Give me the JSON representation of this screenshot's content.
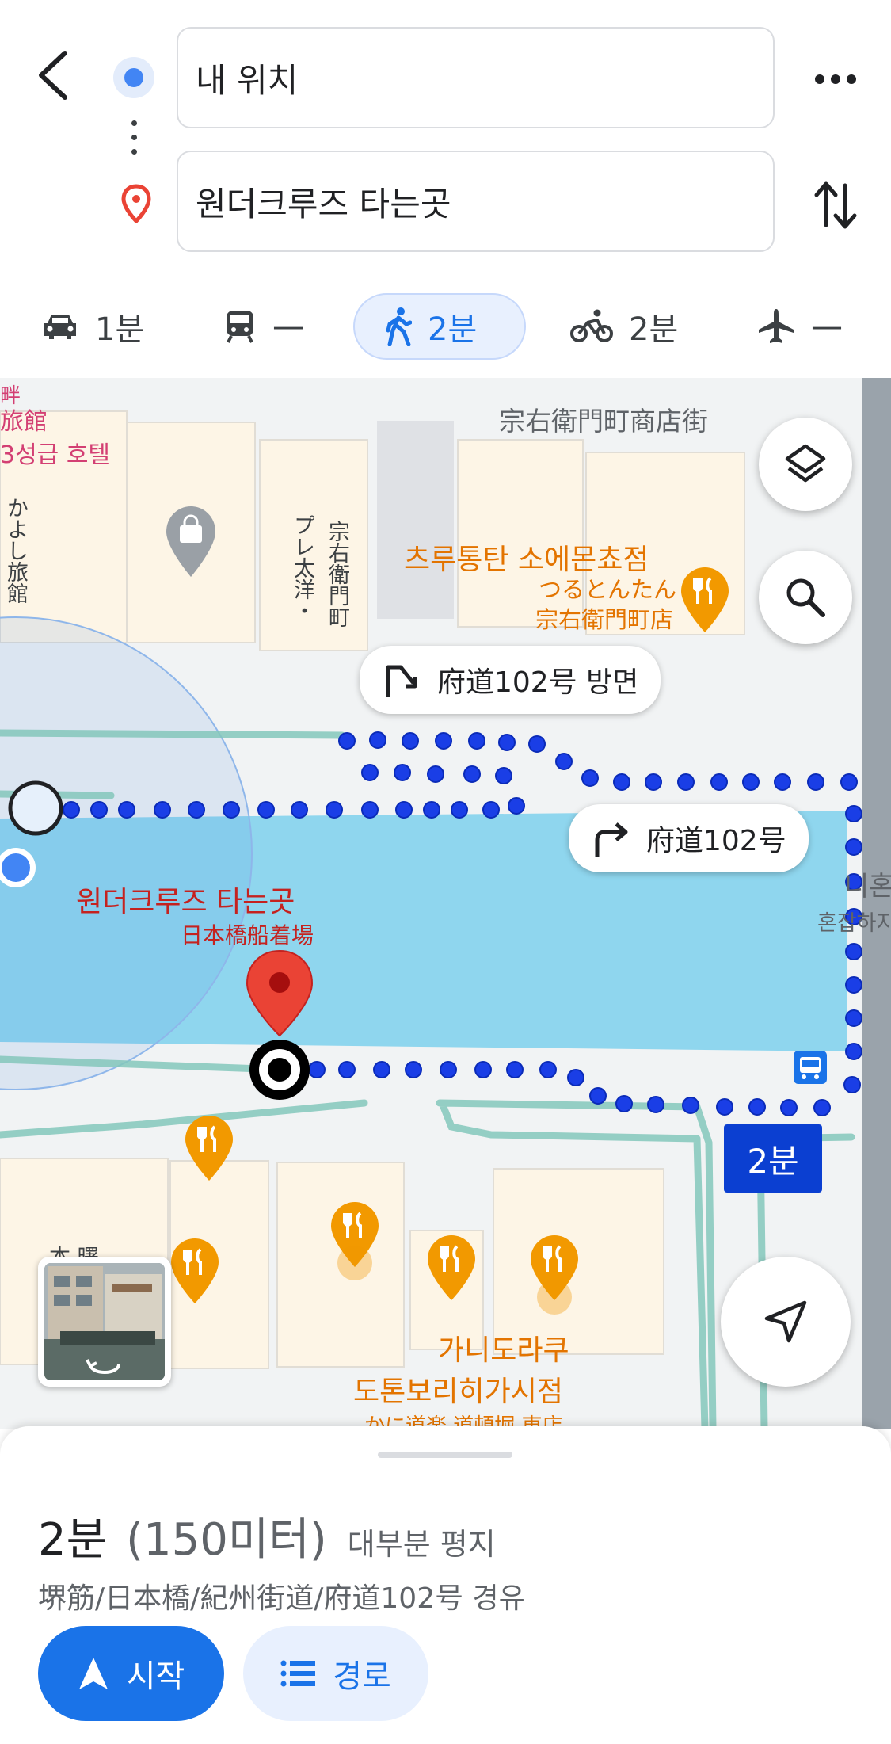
{
  "search": {
    "origin_value": "내 위치",
    "destination_value": "원더크루즈 타는곳"
  },
  "modes": [
    {
      "name": "driving",
      "label": "1분",
      "icon": "car-icon"
    },
    {
      "name": "transit",
      "label": "—",
      "icon": "train-icon"
    },
    {
      "name": "walking",
      "label": "2분",
      "icon": "walk-icon",
      "selected": true
    },
    {
      "name": "cycling",
      "label": "2분",
      "icon": "bike-icon"
    },
    {
      "name": "flight",
      "label": "—",
      "icon": "plane-icon"
    }
  ],
  "map": {
    "street_label": "宗右衛門町商店街",
    "hotel_label_1": "畔",
    "hotel_label_2": "旅館",
    "hotel_label_3": "3성급 호텔",
    "vertical_label_1": "かよし旅館",
    "vertical_label_2a": "プレ太洋・",
    "vertical_label_2b": "宗右衛門町",
    "restaurant_1_ko": "츠루통탄 소에몬쵸점",
    "restaurant_1_ja1": "つるとんたん",
    "restaurant_1_ja2": "宗右衛門町店",
    "restaurant_2_ko1": "가니도라쿠",
    "restaurant_2_ko2": "도톤보리히가시점",
    "restaurant_2_ja": "かに道楽 道頓堀 東店",
    "destination_ko": "원더크루즈 타는곳",
    "destination_ja": "日本橋船着場",
    "right_label_1": "니혼",
    "right_label_2": "혼잡하지",
    "callout_1": "府道102号 방면",
    "callout_2": "府道102号",
    "duration_badge": "2분",
    "small_label": "本 曙"
  },
  "sheet": {
    "time": "2분",
    "distance": "(150미터)",
    "terrain": "대부분 평지",
    "via": "堺筋/日本橋/紀州街道/府道102号 경유",
    "start_label": "시작",
    "steps_label": "경로"
  },
  "colors": {
    "accent": "#1a73e8",
    "route": "#1a3ee6",
    "water": "#8fd6ee",
    "restaurant": "#f29900",
    "destination_pin": "#ea4335",
    "badge": "#0b3fd1"
  }
}
